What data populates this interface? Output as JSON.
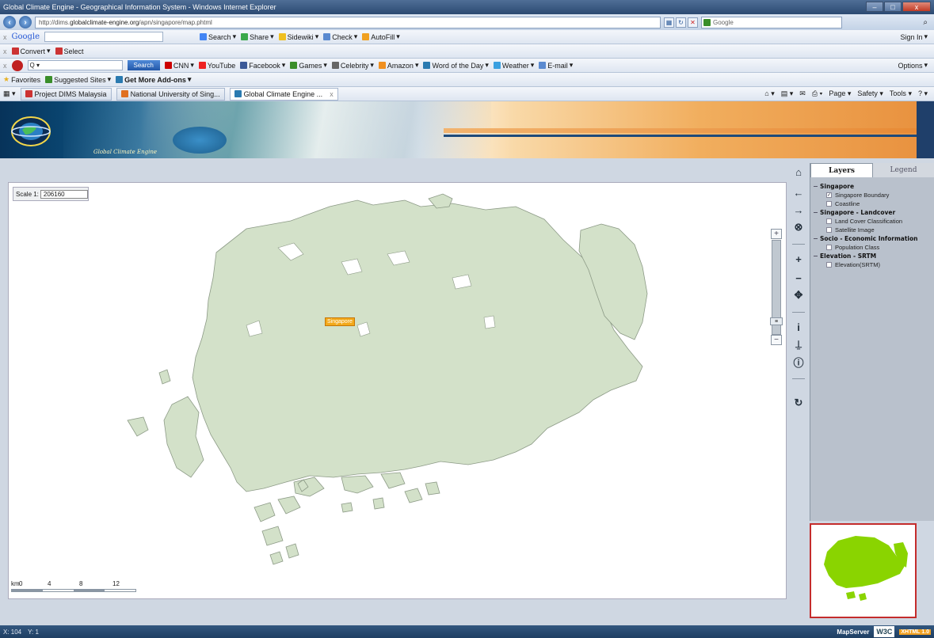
{
  "window": {
    "title": "Global Climate Engine - Geographical Information System - Windows Internet Explorer",
    "url_prefix": "http://dims.",
    "url_domain": "globalclimate-engine.org",
    "url_path": "/apn/singapore/map.phtml",
    "search_provider": "Google",
    "min": "–",
    "max": "□",
    "close": "x"
  },
  "google_toolbar": {
    "logo": "Google",
    "items": [
      "Search",
      "Share",
      "Sidewiki",
      "Check",
      "AutoFill"
    ],
    "signin": "Sign In"
  },
  "convert_toolbar": {
    "convert": "Convert",
    "select": "Select"
  },
  "ask_toolbar": {
    "search_placeholder": "Q ▾",
    "search_button": "Search",
    "items": [
      "CNN",
      "YouTube",
      "Facebook",
      "Games",
      "Celebrity",
      "Amazon",
      "Word of the Day",
      "Weather",
      "E-mail"
    ],
    "options": "Options"
  },
  "favorites_bar": {
    "favorites": "Favorites",
    "suggested": "Suggested Sites",
    "addons": "Get More Add-ons"
  },
  "tabs": [
    {
      "label": "Project DIMS Malaysia"
    },
    {
      "label": "National University of Sing..."
    },
    {
      "label": "Global Climate Engine ..."
    }
  ],
  "command_bar": {
    "page": "Page",
    "safety": "Safety",
    "tools": "Tools"
  },
  "banner": {
    "title": "Global Climate Engine"
  },
  "map": {
    "scale_label": "Scale 1:",
    "scale_value": "206160",
    "city_label": "Singapore",
    "scalebar_unit": "km",
    "scalebar_ticks": [
      "0",
      "4",
      "8",
      "12"
    ],
    "land_color": "#d3e1c9"
  },
  "panel": {
    "tab_layers": "Layers",
    "tab_legend": "Legend",
    "groups": [
      {
        "name": "Singapore",
        "layers": [
          {
            "label": "Singapore Boundary",
            "checked": true
          },
          {
            "label": "Coastline",
            "checked": false
          }
        ]
      },
      {
        "name": "Singapore - Landcover",
        "layers": [
          {
            "label": "Land Cover Classification",
            "checked": false
          },
          {
            "label": "Satellite Image",
            "checked": false
          }
        ]
      },
      {
        "name": "Socio - Economic Information",
        "layers": [
          {
            "label": "Population Class",
            "checked": false
          }
        ]
      },
      {
        "name": "Elevation - SRTM",
        "layers": [
          {
            "label": "Elevation(SRTM)",
            "checked": false
          }
        ]
      }
    ]
  },
  "overview": {
    "land_color": "#8ad400"
  },
  "status": {
    "x": "X: 104",
    "y": "Y: 1",
    "mapserver": "MapServer",
    "w3c": "W3C",
    "xhtml": "XHTML 1.0"
  }
}
